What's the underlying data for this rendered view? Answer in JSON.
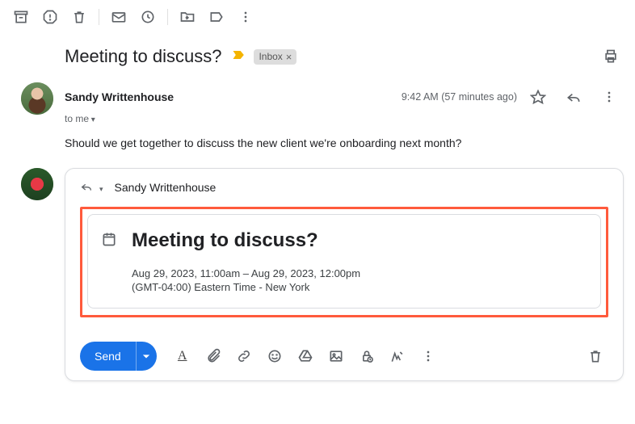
{
  "subject": "Meeting to discuss?",
  "label": "Inbox",
  "sender": {
    "name": "Sandy Writtenhouse"
  },
  "recipients_text": "to me",
  "timestamp": "9:42 AM (57 minutes ago)",
  "body": "Should we get together to discuss the new client we're onboarding next month?",
  "reply": {
    "to_name": "Sandy Writtenhouse",
    "event": {
      "title": "Meeting to discuss?",
      "time_range": "Aug 29, 2023, 11:00am – Aug 29, 2023, 12:00pm",
      "timezone": "(GMT-04:00) Eastern Time - New York"
    },
    "send_label": "Send"
  }
}
